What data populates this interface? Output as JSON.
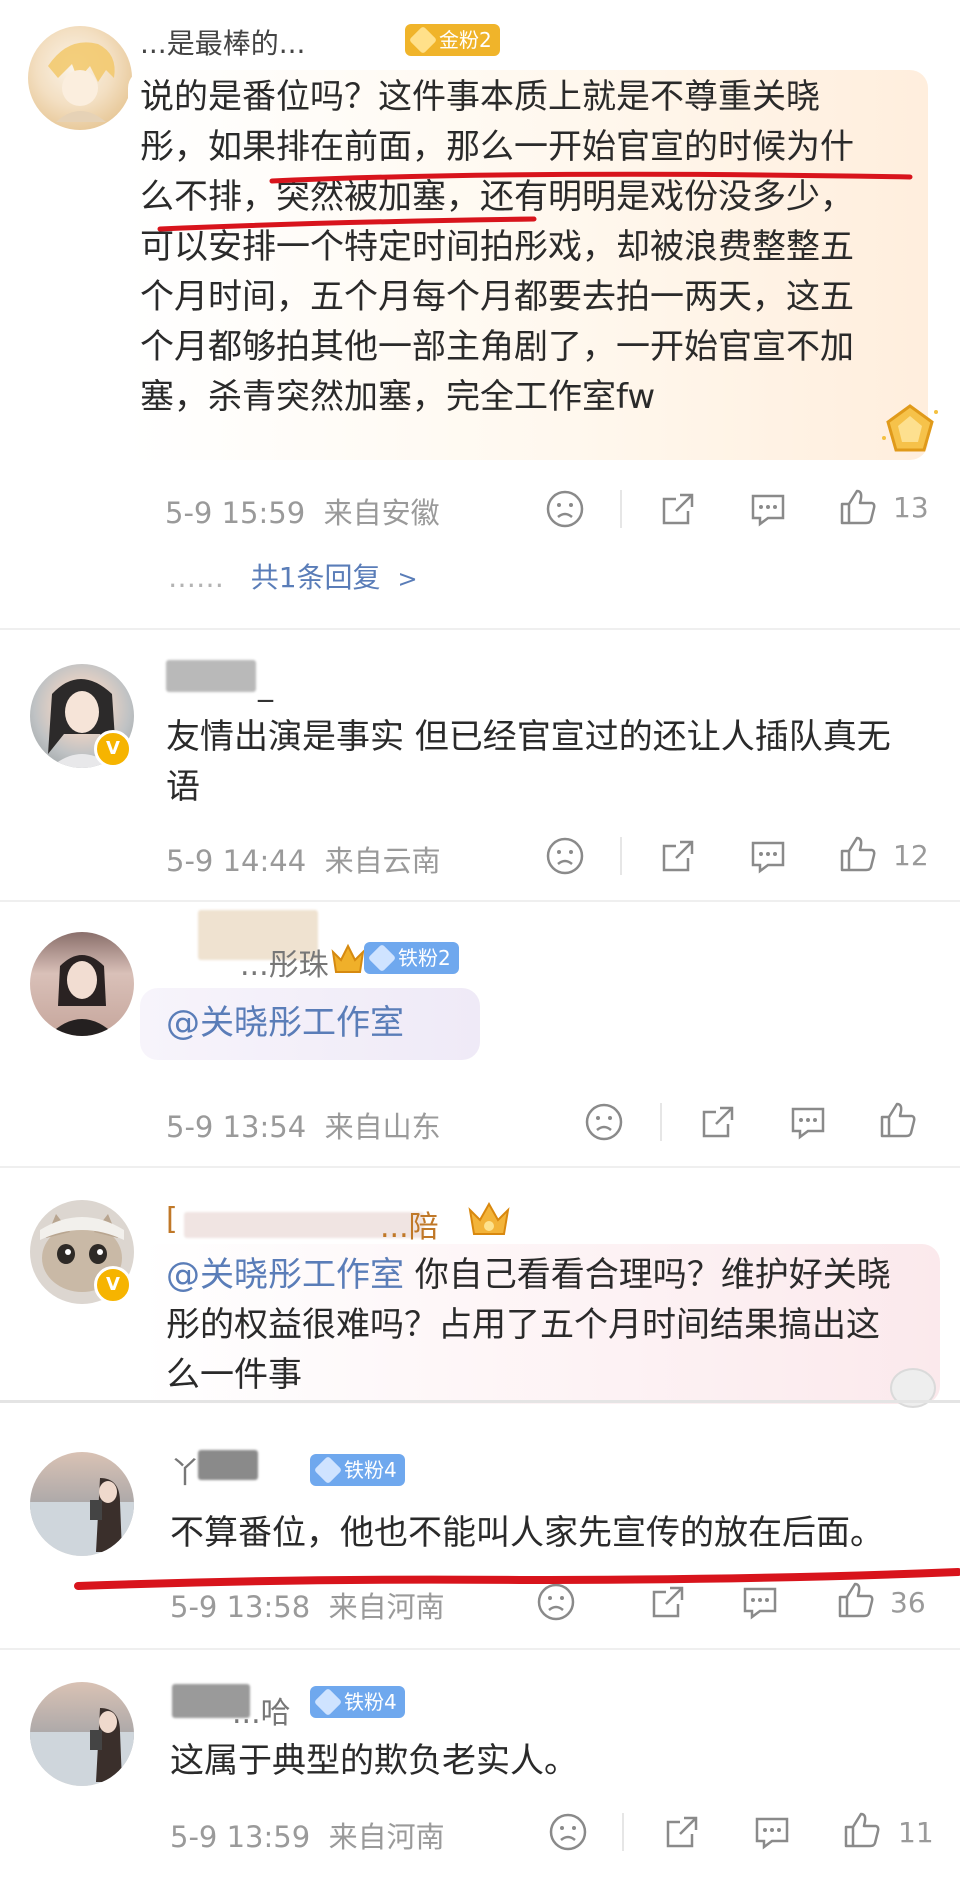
{
  "colors": {
    "accent_link": "#5a7db8",
    "highlight_red": "#d8141c",
    "gold_badge": "#f0b42a",
    "iron_badge": "#6fa8ee",
    "verified": "#f6b400"
  },
  "comments": [
    {
      "username": "...是最棒的...",
      "badge": "金粉2",
      "text": "说的是番位吗？这件事本质上就是不尊重关晓彤，如果排在前面，那么一开始官宣的时候为什么不排，突然被加塞，还有明明是戏份没多少，可以安排一个特定时间拍彤戏，却被浪费整整五个月时间，五个月每个月都要去拍一两天，这五个月都够拍其他一部主角剧了，一开始官宣不加塞，杀青突然加塞，完全工作室fw",
      "lines": [
        "说的是番位吗？这件事本质上就是不尊重关晓",
        "彤，如果排在前面，那么一开始官宣的时候为什",
        "么不排，突然被加塞，还有明明是戏份没多少，",
        "可以安排一个特定时间拍彤戏，却被浪费整整五",
        "个月时间，五个月每个月都要去拍一两天，这五",
        "个月都够拍其他一部主角剧了，一开始官宣不加",
        "塞，杀青突然加塞，完全工作室fw"
      ],
      "time": "5-9 15:59",
      "location": "来自安徽",
      "likes": "13",
      "replies": "共1条回复",
      "replies_prefix": "……"
    },
    {
      "username": "_",
      "text": "友情出演是事实 但已经官宣过的还让人插队真无语",
      "lines": [
        "友情出演是事实 但已经官宣过的还让人插队真无",
        "语"
      ],
      "time": "5-9 14:44",
      "location": "来自云南",
      "likes": "12"
    },
    {
      "username": "...彤珠",
      "badge": "铁粉2",
      "text": "@关晓彤工作室",
      "time": "5-9 13:54",
      "location": "来自山东",
      "likes": ""
    },
    {
      "username": "...陪",
      "text_mention": "@关晓彤工作室",
      "text_rest": " 你自己看看合理吗？维护好关晓",
      "lines": [
        "彤的权益很难吗？占用了五个月时间结果搞出这",
        "么一件事"
      ]
    },
    {
      "username": "丫",
      "badge": "铁粉4",
      "text": "不算番位，他也不能叫人家先宣传的放在后面。",
      "time": "5-9 13:58",
      "location": "来自河南",
      "likes": "36"
    },
    {
      "username": "...哈",
      "badge": "铁粉4",
      "text": "这属于典型的欺负老实人。",
      "time": "5-9 13:59",
      "location": "来自河南",
      "likes": "11"
    }
  ],
  "icons": {
    "dislike": "frown-face-icon",
    "share": "share-icon",
    "comment": "comment-icon",
    "like": "thumbs-up-icon"
  }
}
